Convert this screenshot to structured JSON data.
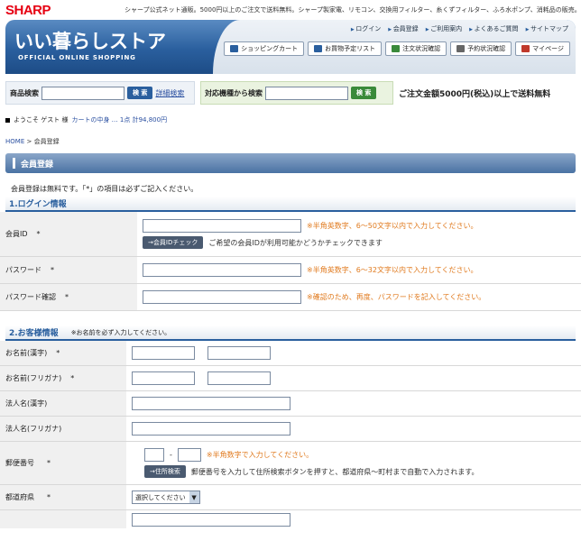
{
  "header": {
    "logo": "SHARP",
    "tagline": "シャープ公式ネット通販。5000円以上のご注文で送料無料。シャープ製家電、リモコン、交換用フィルター、糸くずフィルター、ふろ水ポンプ、消耗品の販売。",
    "banner_title": "いい暮らしストア",
    "banner_sub": "OFFICIAL ONLINE SHOPPING",
    "top_links": [
      "ログイン",
      "会員登録",
      "ご利用案内",
      "よくあるご質問",
      "サイトマップ"
    ],
    "nav_buttons": [
      "ショッピングカート",
      "お買物予定リスト",
      "注文状況確認",
      "予約状況確認",
      "マイページ"
    ]
  },
  "search": {
    "product_label": "商品検索",
    "search_button": "検 索",
    "detail_link": "詳細検索",
    "model_label": "対応機種から検索",
    "model_button": "検 索",
    "free_shipping": "ご注文金額5000円(税込)以上で送料無料"
  },
  "welcome": {
    "text": "ようこそ ゲスト 様",
    "cart_text": "カートの中身 … 1点 計94,800円"
  },
  "breadcrumb": {
    "home": "HOME",
    "sep": ">",
    "current": "会員登録"
  },
  "page_title": "会員登録",
  "intro": "会員登録は無料です。「*」の項目は必ずご記入ください。",
  "sections": {
    "login": {
      "title": "1.ログイン情報",
      "member_id_label": "会員ID",
      "member_id_hint": "※半角英数字、6～50文字以内で入力してください。",
      "check_button": "会員IDチェック",
      "check_desc": "ご希望の会員IDが利用可能かどうかチェックできます",
      "password_label": "パスワード",
      "password_hint": "※半角英数字、6～32文字以内で入力してください。",
      "password_confirm_label": "パスワード確認",
      "password_confirm_hint": "※確認のため、再度、パスワードを記入してください。"
    },
    "customer": {
      "title": "2.お客様情報",
      "note": "※お名前を必ず入力してください。",
      "name_kanji_label": "お名前(漢字)",
      "name_kana_label": "お名前(フリガナ)",
      "corp_kanji_label": "法人名(漢字)",
      "corp_kana_label": "法人名(フリガナ)",
      "zip_label": "郵便番号",
      "zip_dash": "-",
      "zip_hint": "※半角数字で入力してください。",
      "address_search_button": "住所検索",
      "address_search_desc": "郵便番号を入力して住所検索ボタンを押すと、都道府県～町村まで自動で入力されます。",
      "prefecture_label": "都道府県",
      "prefecture_selected": "選択してください"
    }
  },
  "required_mark": "*"
}
